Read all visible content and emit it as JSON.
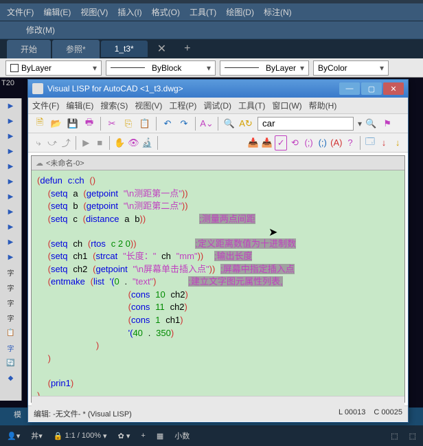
{
  "acad": {
    "menu": [
      "文件(F)",
      "编辑(E)",
      "视图(V)",
      "插入(I)",
      "格式(O)",
      "工具(T)",
      "绘图(D)",
      "标注(N)"
    ],
    "menu2": "修改(M)",
    "tabs": [
      {
        "label": "开始",
        "active": false
      },
      {
        "label": "参照*",
        "active": false
      },
      {
        "label": "1_t3*",
        "active": true
      }
    ],
    "props": {
      "layer": "ByLayer",
      "linetype": "ByBlock",
      "lineweight": "ByLayer",
      "color": "ByColor"
    },
    "t20": "T20",
    "tabname": "模",
    "statusbar": {
      "scale": "1:1 / 100%",
      "mode": "小数"
    }
  },
  "vlisp": {
    "title": "Visual LISP for AutoCAD <1_t3.dwg>",
    "menu": [
      "文件(F)",
      "编辑(E)",
      "搜索(S)",
      "视图(V)",
      "工程(P)",
      "调试(D)",
      "工具(T)",
      "窗口(W)",
      "帮助(H)"
    ],
    "searchText": "car",
    "editorTitle": "<未命名-0>",
    "status": {
      "left": "编辑: -无文件- *  (Visual LISP)",
      "line": "L 00013",
      "col": "C 00025"
    },
    "code": {
      "l1_defun": "defun",
      "l1_name": "c:ch",
      "l2_setq": "setq",
      "l2_a": "a",
      "l2_fn": "getpoint",
      "l2_str": "\"\\n测距第一点\"",
      "l3_setq": "setq",
      "l3_b": "b",
      "l3_fn": "getpoint",
      "l3_str": "\"\\n测距第二点\"",
      "l4_setq": "setq",
      "l4_c": "c",
      "l4_fn": "distance",
      "l4_a": "a",
      "l4_b": "b",
      "l4_cmt": ";测量两点间距",
      "l5_setq": "setq",
      "l5_ch": "ch",
      "l5_fn": "rtos",
      "l5_args": "c 2 0",
      "l5_cmt": ";定义距离数值为十进制数",
      "l6_setq": "setq",
      "l6_ch1": "ch1",
      "l6_fn": "strcat",
      "l6_s1": "\"长度：\"",
      "l6_ch": "ch",
      "l6_s2": "\"mm\"",
      "l6_cmt": ";输出长度",
      "l7_setq": "setq",
      "l7_ch2": "ch2",
      "l7_fn": "getpoint",
      "l7_str": "\"\\n屏幕单击插入点\"",
      "l7_cmt": ";屏幕中指定插入点",
      "l8_fn": "entmake",
      "l8_list": "list",
      "l8_q": "'(",
      "l8_z": "0",
      "l8_dot": ".",
      "l8_txt": "\"text\"",
      "l8_cmt": ";建立文字图元属性列表,",
      "l9_cons": "cons",
      "l9_10": "10",
      "l9_ch2": "ch2",
      "l10_cons": "cons",
      "l10_11": "11",
      "l10_ch2": "ch2",
      "l11_cons": "cons",
      "l11_1": "1",
      "l11_ch1": "ch1",
      "l12_q": "'(",
      "l12_40": "40",
      "l12_dot": ".",
      "l12_350": "350",
      "l13_prin1": "prin1"
    }
  }
}
